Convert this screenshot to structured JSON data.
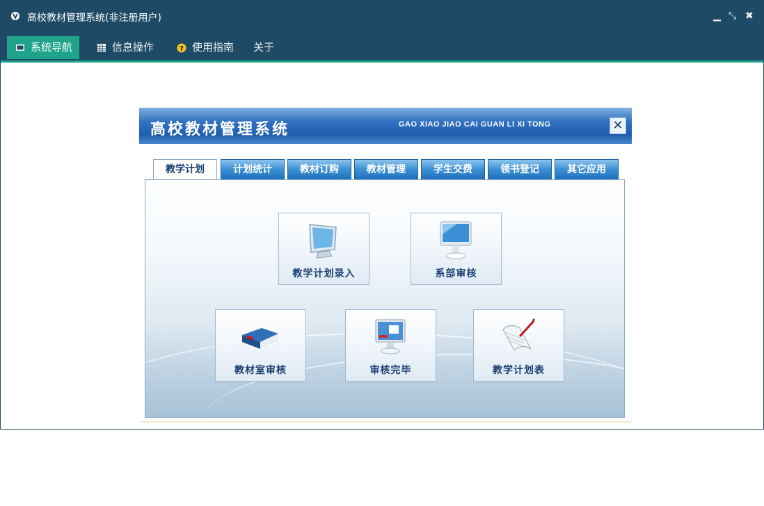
{
  "window": {
    "title": "高校教材管理系统(非注册用户)",
    "controls": {
      "minimize": "▁",
      "restore": "⤡",
      "close": "✖"
    }
  },
  "menu": [
    {
      "label": "系统导航",
      "icon": "monitor-icon",
      "active": true
    },
    {
      "label": "信息操作",
      "icon": "grid-icon",
      "active": false
    },
    {
      "label": "使用指南",
      "icon": "help-icon",
      "active": false
    },
    {
      "label": "关于",
      "icon": "",
      "active": false
    }
  ],
  "panel": {
    "title": "高校教材管理系统",
    "subtitle": "GAO XIAO JIAO CAI GUAN LI XI TONG",
    "close": "✕",
    "tabs": [
      "教学计划",
      "计划统计",
      "教材订购",
      "教材管理",
      "学生交费",
      "领书登记",
      "其它应用"
    ],
    "tiles": [
      {
        "label": "教学计划录入",
        "icon": "monitor-icon"
      },
      {
        "label": "系部审核",
        "icon": "imac-icon"
      },
      {
        "label": "教材室审核",
        "icon": "book-icon"
      },
      {
        "label": "审核完毕",
        "icon": "display-icon"
      },
      {
        "label": "教学计划表",
        "icon": "scroll-quill-icon"
      }
    ]
  },
  "colors": {
    "titlebar": "#1f4a66",
    "accent": "#1fa38a",
    "tab_blue": "#2070bb",
    "label_navy": "#1a3f73"
  }
}
